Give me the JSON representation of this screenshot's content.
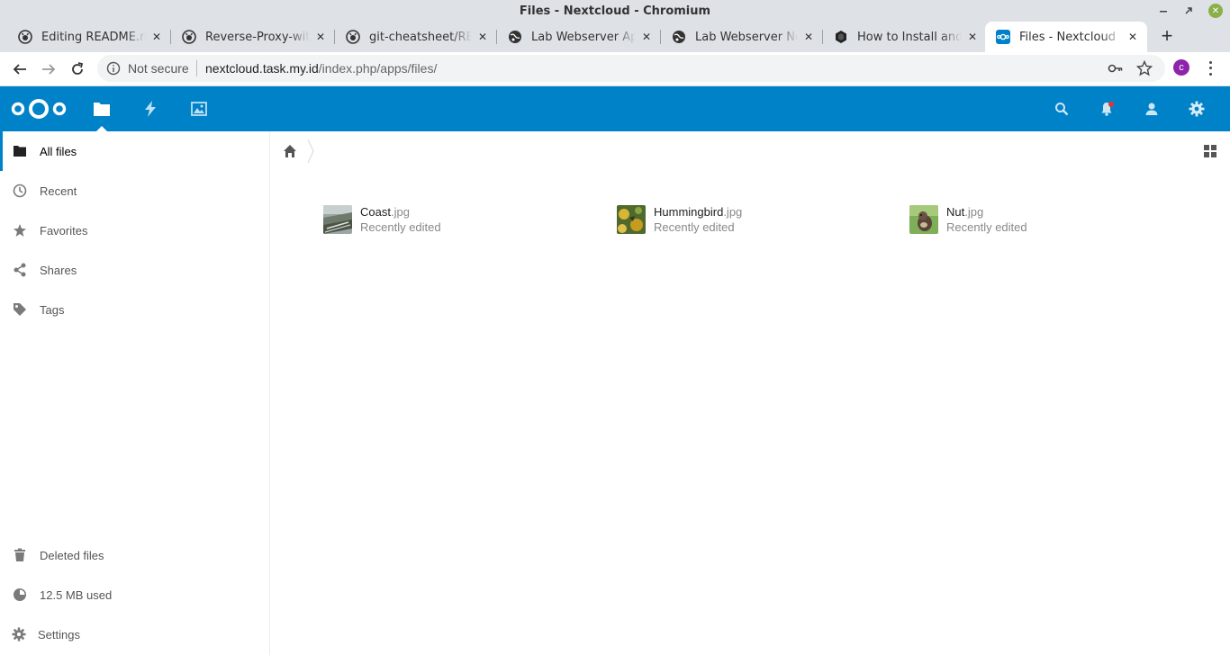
{
  "window": {
    "title": "Files - Nextcloud - Chromium"
  },
  "tabs": [
    {
      "label": "Editing README.md",
      "icon": "github-icon",
      "active": false
    },
    {
      "label": "Reverse-Proxy-with-",
      "icon": "github-icon",
      "active": false
    },
    {
      "label": "git-cheatsheet/README",
      "icon": "github-icon",
      "active": false
    },
    {
      "label": "Lab Webserver Apache",
      "icon": "globe-icon",
      "active": false
    },
    {
      "label": "Lab Webserver Nginx",
      "icon": "globe-icon",
      "active": false
    },
    {
      "label": "How to Install and C",
      "icon": "hexagon-icon",
      "active": false
    },
    {
      "label": "Files - Nextcloud",
      "icon": "nextcloud-icon",
      "active": true
    }
  ],
  "toolbar": {
    "security_label": "Not secure",
    "url_host": "nextcloud.task.my.id",
    "url_path": "/index.php/apps/files/",
    "profile_initial": "c"
  },
  "colors": {
    "brand": "#0082c9",
    "profile": "#8e24aa",
    "notification": "#e9322d"
  },
  "header": {
    "apps": [
      "files-icon",
      "activity-icon",
      "gallery-icon"
    ],
    "right_icons": [
      "search-icon",
      "notifications-icon",
      "contacts-icon",
      "settings-icon"
    ]
  },
  "sidebar": {
    "items": [
      {
        "label": "All files",
        "icon": "folder-icon",
        "active": true
      },
      {
        "label": "Recent",
        "icon": "clock-icon",
        "active": false
      },
      {
        "label": "Favorites",
        "icon": "star-icon",
        "active": false
      },
      {
        "label": "Shares",
        "icon": "share-icon",
        "active": false
      },
      {
        "label": "Tags",
        "icon": "tag-icon",
        "active": false
      }
    ],
    "bottom": {
      "deleted": "Deleted files",
      "quota": "12.5 MB used",
      "settings": "Settings"
    }
  },
  "files": [
    {
      "basename": "Coast",
      "ext": ".jpg",
      "meta": "Recently edited"
    },
    {
      "basename": "Hummingbird",
      "ext": ".jpg",
      "meta": "Recently edited"
    },
    {
      "basename": "Nut",
      "ext": ".jpg",
      "meta": "Recently edited"
    }
  ]
}
